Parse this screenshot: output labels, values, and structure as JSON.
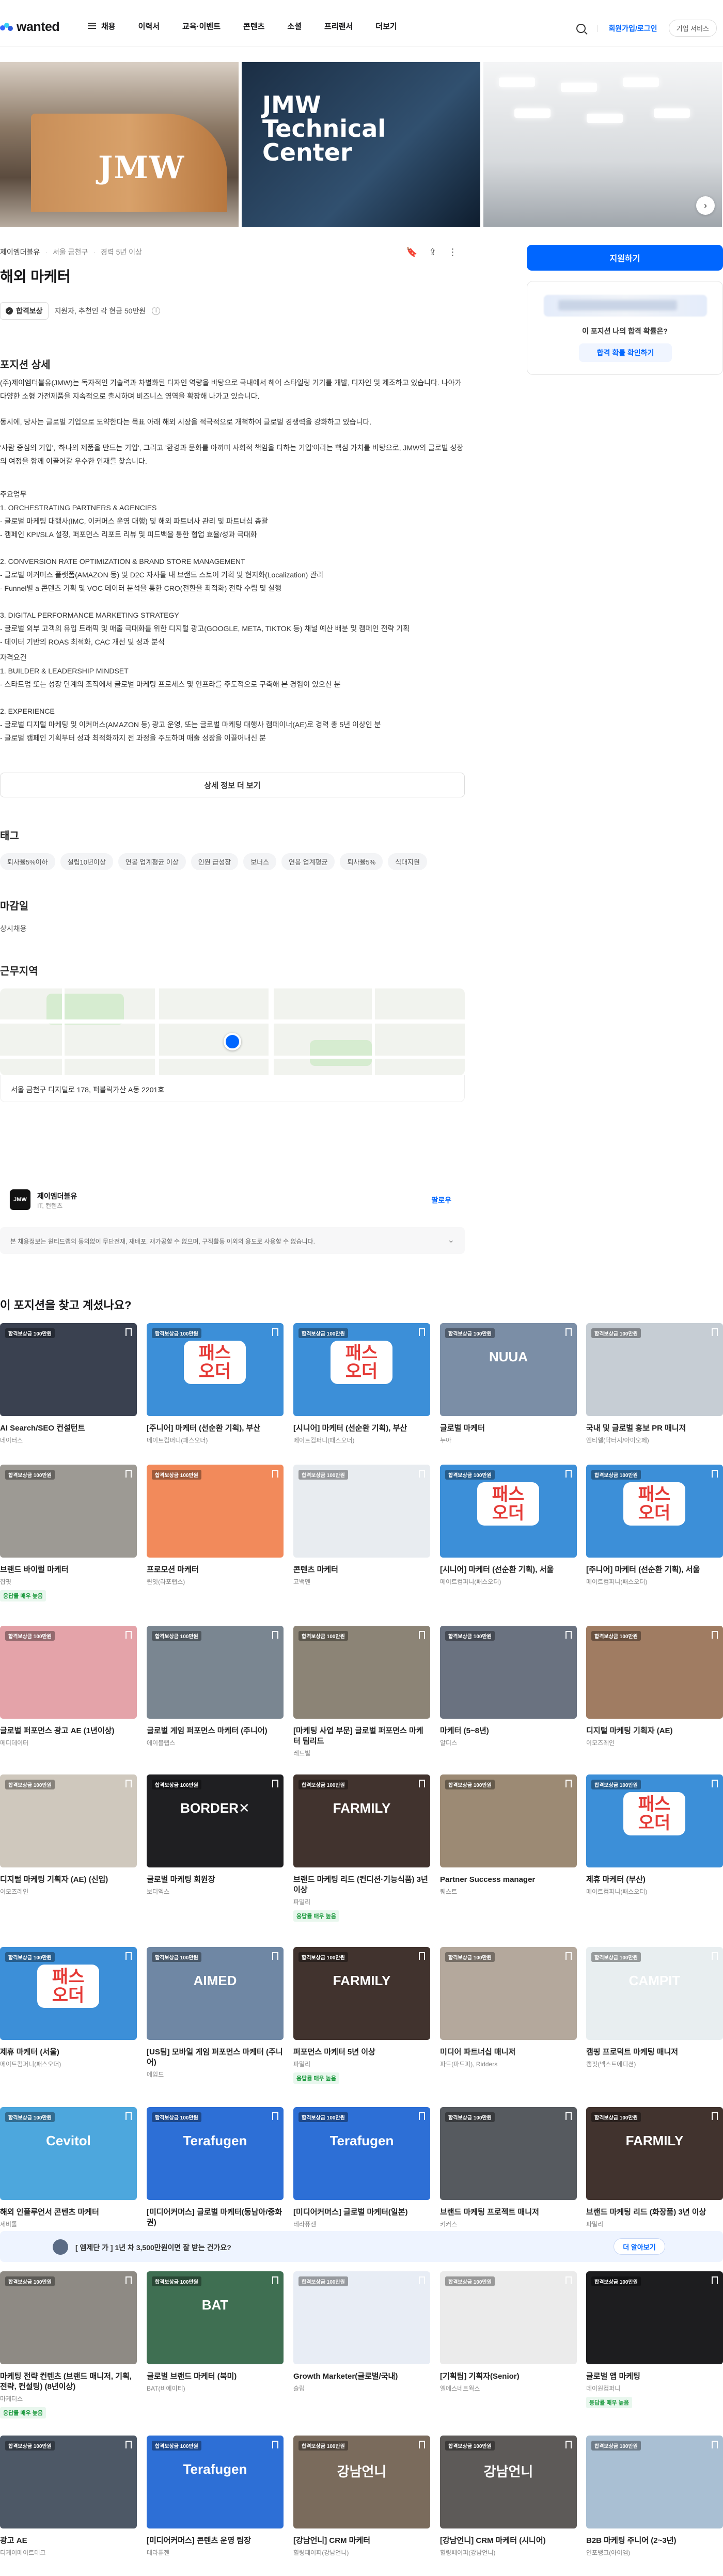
{
  "header": {
    "logo": "wanted",
    "nav": [
      "채용",
      "이력서",
      "교육·이벤트",
      "콘텐츠",
      "소셜",
      "프리랜서",
      "더보기"
    ],
    "login": "회원가입/로그인",
    "corp": "기업 서비스"
  },
  "job": {
    "company": "제이엠더블유",
    "location": "서울 금천구",
    "experience": "경력 5년 이상",
    "title": "해외 마케터",
    "reward_badge": "합격보상",
    "reward_text": "지원자, 추천인 각 현금 50만원"
  },
  "sidebar": {
    "apply": "지원하기",
    "question": "이 포지션 나의 합격 확률은?",
    "check": "합격 확률 확인하기"
  },
  "detail": {
    "heading": "포지션 상세",
    "intro": [
      "(주)제이엠더블유(JMW)는 독자적인 기술력과 차별화된 디자인 역량을 바탕으로 국내에서 헤어 스타일링 기기를 개발, 디자인 및 제조하고 있습니다. 나아가 다양한 소형 가전제품을 지속적으로 출시하며 비즈니스 영역을 확장해 나가고 있습니다.",
      "동시에, 당사는 글로벌 기업으로 도약한다는 목표 아래 해외 시장을 적극적으로 개척하여 글로벌 경쟁력을 강화하고 있습니다.",
      "'사람 중심의 기업', '하나의 제품을 만드는 기업', 그리고 '환경과 문화를 아끼며 사회적 책임을 다하는 기업'이라는 핵심 가치를 바탕으로, JMW의 글로벌 성장의 여정을 함께 이끌어갈 우수한 인재를 찾습니다."
    ],
    "tasks_heading": "주요업무",
    "tasks": [
      "1. ORCHESTRATING PARTNERS & AGENCIES",
      "- 글로벌 마케팅 대행사(IMC, 이커머스 운영 대행) 및 해외 파트너사 관리 및 파트너십 총괄",
      "- 캠페인 KPI/SLA 설정, 퍼포먼스 리포트 리뷰 및 피드백을 통한 협업 효율/성과 극대화",
      "",
      "2. CONVERSION RATE OPTIMIZATION & BRAND STORE MANAGEMENT",
      "- 글로벌 이커머스 플랫폼(AMAZON 등) 및 D2C 자사몰 내 브랜드 스토어 기획 및 현지화(Localization) 관리",
      "- Funnel별 a 콘텐츠 기획 및 VOC 데이터 분석을 통한 CRO(전환율 최적화) 전략 수립 및 실행",
      "",
      "3. DIGITAL PERFORMANCE MARKETING STRATEGY",
      "- 글로벌 외부 고객의 유입 트래픽 및 매출 극대화를 위한 디지털 광고(GOOGLE, META, TIKTOK 등) 채널 예산 배분 및 캠페인 전략 기획",
      "- 데이터 기반의 ROAS 최적화, CAC 개선 및 성과 분석"
    ],
    "quals_heading": "자격요건",
    "quals": [
      "1. BUILDER & LEADERSHIP MINDSET",
      "- 스타트업 또는 성장 단계의 조직에서 글로벌 마케팅 프로세스 및 인프라를 주도적으로 구축해 본 경험이 있으신 분",
      "",
      "2. EXPERIENCE",
      "- 글로벌 디지털 마케팅 및 이커머스(AMAZON 등) 광고 운영, 또는 글로벌 마케팅 대행사 캠페이너(AE)로 경력 총 5년 이상인 분",
      "- 글로벌 캠페인 기획부터 성과 최적화까지 전 과정을 주도하며 매출 성장을 이끌어내신 분"
    ],
    "more": "상세 정보 더 보기"
  },
  "tags": {
    "heading": "태그",
    "items": [
      "퇴사율5%이하",
      "설립10년이상",
      "연봉 업계평균 이상",
      "인원 급성장",
      "보너스",
      "연봉 업계평균",
      "퇴사율5%",
      "식대지원"
    ]
  },
  "deadline": {
    "heading": "마감일",
    "value": "상시채용"
  },
  "workplace": {
    "heading": "근무지역",
    "address": "서울 금천구 디지털로 178, 퍼블릭가산 A동 2201호"
  },
  "company_card": {
    "logo": "JMW",
    "name": "제이엠더블유",
    "industry": "IT, 컨텐츠",
    "follow": "팔로우",
    "notice": "본 채용정보는 원티드랩의 동의없이 무단전재, 재배포, 재가공할 수 없으며, 구직활동 이외의 용도로 사용할 수 없습니다."
  },
  "recommend": {
    "heading": "이 포지션을 찾고 계셨나요?",
    "badge": "합격보상금 100만원",
    "reply_badge": "응답률 매우 높음",
    "cards": [
      {
        "title": "AI Search/SEO 컨설턴트",
        "company": "데이터스",
        "bg": "#3a4150",
        "label": "",
        "badge": false
      },
      {
        "title": "[주니어] 마케터 (선순환 기획), 부산",
        "company": "메이트컴퍼니(패스오더)",
        "bg": "#3c8fd8",
        "label": "패스\n오더",
        "badge": false
      },
      {
        "title": "[시니어] 마케터 (선순환 기획), 부산",
        "company": "메이트컴퍼니(패스오더)",
        "bg": "#3c8fd8",
        "label": "패스\n오더",
        "badge": false
      },
      {
        "title": "글로벌 마케터",
        "company": "누아",
        "bg": "#7b8ea6",
        "label": "NUUA",
        "badge": false
      },
      {
        "title": "국내 및 글로벌 홍보 PR 매니저",
        "company": "엔티엘(닥터지/아이오페)",
        "bg": "#c6cdd4",
        "label": "",
        "badge": false
      },
      {
        "title": "브랜드 바이럴 마케터",
        "company": "잡핏",
        "bg": "#9d9a94",
        "label": "",
        "badge": true
      },
      {
        "title": "프로모션 마케터",
        "company": "퀸잇(라포랩스)",
        "bg": "#f28a5b",
        "label": "",
        "badge": false
      },
      {
        "title": "콘텐츠 마케터",
        "company": "고백멘",
        "bg": "#e8ecf0",
        "label": "",
        "badge": false
      },
      {
        "title": "[시니어] 마케터 (선순환 기획), 서울",
        "company": "메이트컴퍼니(패스오더)",
        "bg": "#3c8fd8",
        "label": "패스\n오더",
        "badge": false
      },
      {
        "title": "[주니어] 마케터 (선순환 기획), 서울",
        "company": "메이트컴퍼니(패스오더)",
        "bg": "#3c8fd8",
        "label": "패스\n오더",
        "badge": false
      },
      {
        "title": "글로벌 퍼포먼스 광고 AE (1년이상)",
        "company": "메디데이터",
        "bg": "#e4a3a9",
        "label": "",
        "badge": false
      },
      {
        "title": "글로벌 게임 퍼포먼스 마케터 (주니어)",
        "company": "에이블랩스",
        "bg": "#7a8691",
        "label": "",
        "badge": false
      },
      {
        "title": "[마케팅 사업 부문] 글로벌 퍼포먼스 마케터 팀리드",
        "company": "레드빌",
        "bg": "#8c8476",
        "label": "",
        "badge": false
      },
      {
        "title": "마케터 (5~8년)",
        "company": "알디스",
        "bg": "#6a7280",
        "label": "",
        "badge": false
      },
      {
        "title": "디지털 마케팅 기획자 (AE)",
        "company": "이모즈레인",
        "bg": "#a07c62",
        "label": "",
        "badge": false
      },
      {
        "title": "디지털 마케팅 기획자 (AE) (신입)",
        "company": "이모즈레인",
        "bg": "#cfc8bd",
        "label": "",
        "badge": false
      },
      {
        "title": "글로벌 마케팅 회원장",
        "company": "보더엑스",
        "bg": "#1f1f22",
        "label": "BORDER✕",
        "badge": false
      },
      {
        "title": "브랜드 마케팅 리드 (컨디션·기능식품) 3년 이상",
        "company": "파밀리",
        "bg": "#41332e",
        "label": "FARMILY",
        "badge": true
      },
      {
        "title": "Partner Success manager",
        "company": "퀘스트",
        "bg": "#9c8a74",
        "label": "",
        "badge": false
      },
      {
        "title": "제휴 마케터 (부산)",
        "company": "메이트컴퍼니(패스오더)",
        "bg": "#3c8fd8",
        "label": "패스\n오더",
        "badge": false
      },
      {
        "title": "제휴 마케터 (서울)",
        "company": "메이트컴퍼니(패스오더)",
        "bg": "#3c8fd8",
        "label": "패스\n오더",
        "badge": false
      },
      {
        "title": "[US팀] 모바일 게임 퍼포먼스 마케터 (주니어)",
        "company": "에임드",
        "bg": "#6f87a4",
        "label": "AIMED",
        "badge": false
      },
      {
        "title": "퍼포먼스 마케터 5년 이상",
        "company": "파밀리",
        "bg": "#41332e",
        "label": "FARMILY",
        "badge": true
      },
      {
        "title": "미디어 파트너십 매니저",
        "company": "파드(파드피), Ridders",
        "bg": "#b4a89c",
        "label": "",
        "badge": false
      },
      {
        "title": "캠핑 프로덕트 마케팅 매니저",
        "company": "캠핏(넥스트에디션)",
        "bg": "#e8eef0",
        "label": "CAMPIT",
        "badge": false
      },
      {
        "title": "해외 인플루언서 콘텐츠 마케터",
        "company": "세비톨",
        "bg": "#4da7dd",
        "label": "Cevitol",
        "badge": false
      },
      {
        "title": "[미디어커머스] 글로벌 마케터(동남아/중화권)",
        "company": "테라퓨젠",
        "bg": "#2d6fd6",
        "label": "Terafugen",
        "badge": false
      },
      {
        "title": "[미디어커머스] 글로벌 마케터(일본)",
        "company": "테라퓨젠",
        "bg": "#2d6fd6",
        "label": "Terafugen",
        "badge": false
      },
      {
        "title": "브랜드 마케팅 프로젝트 매니저",
        "company": "키커스",
        "bg": "#565a5f",
        "label": "",
        "badge": false
      },
      {
        "title": "브랜드 마케팅 리드 (화장품) 3년 이상",
        "company": "파밀리",
        "bg": "#41332e",
        "label": "FARMILY",
        "badge": false
      },
      {
        "title": "마케팅 전략 컨텐츠 (브랜드 매니저, 기획, 전략, 컨설팅) (8년이상)",
        "company": "마케터스",
        "bg": "#8e8a84",
        "label": "",
        "badge": true
      },
      {
        "title": "글로벌 브랜드 마케터 (북미)",
        "company": "BAT(비에이티)",
        "bg": "#3f6f52",
        "label": "BAT",
        "badge": false
      },
      {
        "title": "Growth Marketer(글로벌/국내)",
        "company": "슬립",
        "bg": "#e8edf5",
        "label": "",
        "badge": false
      },
      {
        "title": "[기획팀] 기획자(Senior)",
        "company": "엘에스네트웍스",
        "bg": "#ebebeb",
        "label": "",
        "badge": false
      },
      {
        "title": "글로벌 앱 마케팅",
        "company": "데이원컴퍼니",
        "bg": "#1d1d1f",
        "label": "",
        "badge": true
      },
      {
        "title": "광고 AE",
        "company": "디케이메이트테크",
        "bg": "#4d5866",
        "label": "",
        "badge": false
      },
      {
        "title": "[미디어커머스] 콘텐츠 운영 팀장",
        "company": "테라퓨젠",
        "bg": "#2d6fd6",
        "label": "Terafugen",
        "badge": false
      },
      {
        "title": "[강남언니] CRM 마케터",
        "company": "힐링페이퍼(강남언니)",
        "bg": "#7a6b5c",
        "label": "강남언니",
        "badge": false
      },
      {
        "title": "[강남언니] CRM 마케터 (시니어)",
        "company": "힐링페이퍼(강남언니)",
        "bg": "#5d5a58",
        "label": "강남언니",
        "badge": false
      },
      {
        "title": "B2B 마케팅 주니어 (2~3년)",
        "company": "인포뱅크(아이엠)",
        "bg": "#a9bfd3",
        "label": "",
        "badge": false
      }
    ]
  },
  "banner": {
    "text": "[ 엠제단 가 ] 1년 차 3,500만원이면 잘 받는 건가요?",
    "button": "더 알아보기"
  }
}
